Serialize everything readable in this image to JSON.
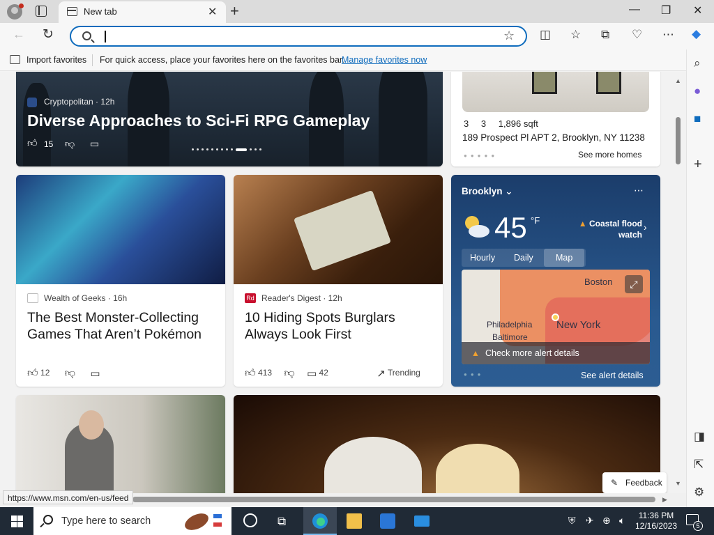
{
  "browser": {
    "tab_title": "New tab",
    "address_value": "",
    "favorites": {
      "import_label": "Import favorites",
      "message": "For quick access, place your favorites here on the favorites bar.",
      "manage_link": "Manage favorites now"
    },
    "status_url": "https://www.msn.com/en-us/feed"
  },
  "feed": {
    "hero": {
      "source": "Cryptopolitan",
      "age": "12h",
      "title": "Diverse Approaches to Sci-Fi RPG Gameplay",
      "likes": "15"
    },
    "home_listing": {
      "beds": "3",
      "baths": "3",
      "sqft": "1,896 sqft",
      "address": "189 Prospect Pl APT 2, Brooklyn, NY 11238",
      "more_label": "See more homes"
    },
    "articles": [
      {
        "source": "Wealth of Geeks",
        "age": "16h",
        "title": "The Best Monster-Collecting Games That Aren’t Pokémon",
        "likes": "12"
      },
      {
        "source": "Reader's Digest",
        "source_badge": "Rd",
        "age": "12h",
        "title": "10 Hiding Spots Burglars Always Look First",
        "likes": "413",
        "comments": "42",
        "trending_label": "Trending"
      }
    ]
  },
  "weather": {
    "city": "Brooklyn",
    "temperature": "45",
    "unit": "°F",
    "alert": "Coastal flood watch",
    "tabs": [
      "Hourly",
      "Daily",
      "Map"
    ],
    "active_tab": "Map",
    "map_labels": {
      "boston": "Boston",
      "philadelphia": "Philadelphia",
      "new_york": "New York",
      "baltimore": "Baltimore"
    },
    "alert_cta": "Check more alert details",
    "see_alert": "See alert details"
  },
  "feedback_label": "Feedback",
  "taskbar": {
    "search_placeholder": "Type here to search",
    "time": "11:36 PM",
    "date": "12/16/2023",
    "notification_count": "5"
  },
  "colors": {
    "accent": "#0f6cbd",
    "taskbar": "#202a36",
    "weather_card": "#1b3d6b"
  }
}
